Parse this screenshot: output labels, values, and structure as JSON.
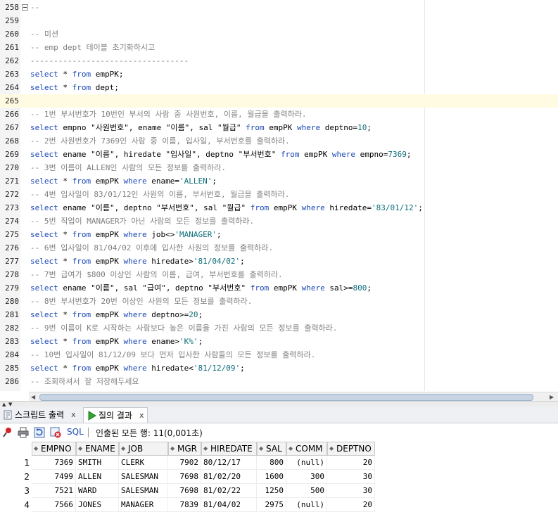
{
  "editor": {
    "lines": [
      {
        "n": "258",
        "fold": true,
        "tokens": [
          {
            "t": "--",
            "c": "cm"
          }
        ]
      },
      {
        "n": "259",
        "tokens": []
      },
      {
        "n": "260",
        "tokens": [
          {
            "t": "-- 미션",
            "c": "cm"
          }
        ]
      },
      {
        "n": "261",
        "tokens": [
          {
            "t": "-- emp dept 테이블 초기화하시고",
            "c": "cm"
          }
        ]
      },
      {
        "n": "262",
        "tokens": [
          {
            "t": "----------------------------------",
            "c": "cm"
          }
        ]
      },
      {
        "n": "263",
        "tokens": [
          {
            "t": "select",
            "c": "kw"
          },
          {
            "t": " * "
          },
          {
            "t": "from",
            "c": "kw"
          },
          {
            "t": " empPK;"
          }
        ]
      },
      {
        "n": "264",
        "tokens": [
          {
            "t": "select",
            "c": "kw"
          },
          {
            "t": " * "
          },
          {
            "t": "from",
            "c": "kw"
          },
          {
            "t": " dept;"
          }
        ]
      },
      {
        "n": "265",
        "current": true,
        "tokens": []
      },
      {
        "n": "266",
        "tokens": [
          {
            "t": "-- 1번 부서번호가 10번인 부서의 사람 중 사원번호, 이름, 월급을 출력하라.",
            "c": "cm"
          }
        ]
      },
      {
        "n": "267",
        "tokens": [
          {
            "t": "select",
            "c": "kw"
          },
          {
            "t": " empno \"사원번호\", ename \"이름\", sal \"월급\" "
          },
          {
            "t": "from",
            "c": "kw"
          },
          {
            "t": " empPK "
          },
          {
            "t": "where",
            "c": "kw"
          },
          {
            "t": " deptno="
          },
          {
            "t": "10",
            "c": "num"
          },
          {
            "t": ";"
          }
        ]
      },
      {
        "n": "268",
        "tokens": [
          {
            "t": "-- 2번 사원번호가 7369인 사람 중 이름, 입사일, 부서번호를 출력하라.",
            "c": "cm"
          }
        ]
      },
      {
        "n": "269",
        "tokens": [
          {
            "t": "select",
            "c": "kw"
          },
          {
            "t": " ename \"이름\", hiredate \"입사일\", deptno \"부서번호\" "
          },
          {
            "t": "from",
            "c": "kw"
          },
          {
            "t": " empPK "
          },
          {
            "t": "where",
            "c": "kw"
          },
          {
            "t": " empno="
          },
          {
            "t": "7369",
            "c": "num"
          },
          {
            "t": ";"
          }
        ]
      },
      {
        "n": "270",
        "tokens": [
          {
            "t": "-- 3번 이름이 ALLEN인 사람의 모든 정보를 출력하라.",
            "c": "cm"
          }
        ]
      },
      {
        "n": "271",
        "tokens": [
          {
            "t": "select",
            "c": "kw"
          },
          {
            "t": " * "
          },
          {
            "t": "from",
            "c": "kw"
          },
          {
            "t": " empPK "
          },
          {
            "t": "where",
            "c": "kw"
          },
          {
            "t": " ename="
          },
          {
            "t": "'ALLEN'",
            "c": "str"
          },
          {
            "t": ";"
          }
        ]
      },
      {
        "n": "272",
        "tokens": [
          {
            "t": "-- 4번 입사일이 83/01/12인 사원의 이름, 부서번호, 월급을 출력하라.",
            "c": "cm"
          }
        ]
      },
      {
        "n": "273",
        "tokens": [
          {
            "t": "select",
            "c": "kw"
          },
          {
            "t": " ename \"이름\", deptno \"부서번호\", sal \"월급\" "
          },
          {
            "t": "from",
            "c": "kw"
          },
          {
            "t": " empPK "
          },
          {
            "t": "where",
            "c": "kw"
          },
          {
            "t": " hiredate="
          },
          {
            "t": "'83/01/12'",
            "c": "str"
          },
          {
            "t": ";"
          }
        ]
      },
      {
        "n": "274",
        "tokens": [
          {
            "t": "-- 5번 직업이 MANAGER가 아닌 사람의 모든 정보를 출력하라.",
            "c": "cm"
          }
        ]
      },
      {
        "n": "275",
        "tokens": [
          {
            "t": "select",
            "c": "kw"
          },
          {
            "t": " * "
          },
          {
            "t": "from",
            "c": "kw"
          },
          {
            "t": " empPK "
          },
          {
            "t": "where",
            "c": "kw"
          },
          {
            "t": " job<>"
          },
          {
            "t": "'MANAGER'",
            "c": "str"
          },
          {
            "t": ";"
          }
        ]
      },
      {
        "n": "276",
        "tokens": [
          {
            "t": "-- 6번 입사일이 81/04/02 이후에 입사한 사원의 정보를 출력하라.",
            "c": "cm"
          }
        ]
      },
      {
        "n": "277",
        "tokens": [
          {
            "t": "select",
            "c": "kw"
          },
          {
            "t": " * "
          },
          {
            "t": "from",
            "c": "kw"
          },
          {
            "t": " empPK "
          },
          {
            "t": "where",
            "c": "kw"
          },
          {
            "t": " hiredate>"
          },
          {
            "t": "'81/04/02'",
            "c": "str"
          },
          {
            "t": ";"
          }
        ]
      },
      {
        "n": "278",
        "tokens": [
          {
            "t": "-- 7번 급여가 $800 이상인 사람의 이름, 급여, 부서번호를 출력하라.",
            "c": "cm"
          }
        ]
      },
      {
        "n": "279",
        "tokens": [
          {
            "t": "select",
            "c": "kw"
          },
          {
            "t": " ename \"이름\", sal \"급여\", deptno \"부서번호\" "
          },
          {
            "t": "from",
            "c": "kw"
          },
          {
            "t": " empPK "
          },
          {
            "t": "where",
            "c": "kw"
          },
          {
            "t": " sal>="
          },
          {
            "t": "800",
            "c": "num"
          },
          {
            "t": ";"
          }
        ]
      },
      {
        "n": "280",
        "tokens": [
          {
            "t": "-- 8번 부서번호가 20번 이상인 사원의 모든 정보를 출력하라.",
            "c": "cm"
          }
        ]
      },
      {
        "n": "281",
        "tokens": [
          {
            "t": "select",
            "c": "kw"
          },
          {
            "t": " * "
          },
          {
            "t": "from",
            "c": "kw"
          },
          {
            "t": " empPK "
          },
          {
            "t": "where",
            "c": "kw"
          },
          {
            "t": " deptno>="
          },
          {
            "t": "20",
            "c": "num"
          },
          {
            "t": ";"
          }
        ]
      },
      {
        "n": "282",
        "tokens": [
          {
            "t": "-- 9번 이름이 K로 시작하는 사람보다 높은 이름을 가진 사람의 모든 정보를 출력하라.",
            "c": "cm"
          }
        ]
      },
      {
        "n": "283",
        "tokens": [
          {
            "t": "select",
            "c": "kw"
          },
          {
            "t": " * "
          },
          {
            "t": "from",
            "c": "kw"
          },
          {
            "t": " empPK "
          },
          {
            "t": "where",
            "c": "kw"
          },
          {
            "t": " ename>"
          },
          {
            "t": "'K%'",
            "c": "str"
          },
          {
            "t": ";"
          }
        ]
      },
      {
        "n": "284",
        "tokens": [
          {
            "t": "-- 10번 입사일이 81/12/09 보다 먼저 입사한 사람들의 모든 정보를 출력하라.",
            "c": "cm"
          }
        ]
      },
      {
        "n": "285",
        "tokens": [
          {
            "t": "select",
            "c": "kw"
          },
          {
            "t": " * "
          },
          {
            "t": "from",
            "c": "kw"
          },
          {
            "t": " empPK "
          },
          {
            "t": "where",
            "c": "kw"
          },
          {
            "t": " hiredate<"
          },
          {
            "t": "'81/12/09'",
            "c": "str"
          },
          {
            "t": ";"
          }
        ]
      },
      {
        "n": "286",
        "tokens": [
          {
            "t": "-- 조회하셔서 잘 저장해두세요",
            "c": "cm"
          }
        ]
      }
    ]
  },
  "tabs": [
    {
      "label": "스크립트 출력",
      "close": "x",
      "icon": "script-output-icon",
      "active": false
    },
    {
      "label": "질의 결과",
      "close": "x",
      "icon": "run-query-icon",
      "active": true
    }
  ],
  "toolbar": {
    "sql_label": "SQL",
    "status": "인출된 모든 행: 11(0,001초)"
  },
  "results": {
    "columns": [
      "EMPNO",
      "ENAME",
      "JOB",
      "MGR",
      "HIREDATE",
      "SAL",
      "COMM",
      "DEPTNO"
    ],
    "rows": [
      [
        "1",
        "7369",
        "SMITH",
        "CLERK",
        "7902",
        "80/12/17",
        "800",
        "(null)",
        "20"
      ],
      [
        "2",
        "7499",
        "ALLEN",
        "SALESMAN",
        "7698",
        "81/02/20",
        "1600",
        "300",
        "30"
      ],
      [
        "3",
        "7521",
        "WARD",
        "SALESMAN",
        "7698",
        "81/02/22",
        "1250",
        "500",
        "30"
      ],
      [
        "4",
        "7566",
        "JONES",
        "MANAGER",
        "7839",
        "81/04/02",
        "2975",
        "(null)",
        "20"
      ]
    ]
  }
}
